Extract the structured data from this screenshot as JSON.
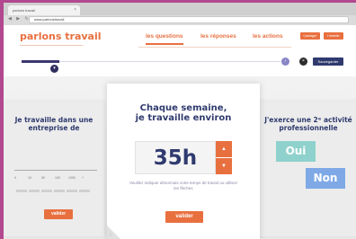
{
  "browser": {
    "tab_title": "parlons travail",
    "tab_close": "×",
    "nav_glyphs": "◀ ▶ ↻",
    "url": "www.parlonstravail"
  },
  "header": {
    "logo": "parlons travail",
    "nav": [
      {
        "label": "les questions",
        "active": true
      },
      {
        "label": "les réponses",
        "active": false
      },
      {
        "label": "les actions",
        "active": false
      }
    ],
    "share_buttons": [
      "f partager",
      "t tweeter"
    ]
  },
  "progress": {
    "value": 0.13,
    "knob_glyph": "▾",
    "next_glyph": "›",
    "close_glyph": "×",
    "save_label": "Sauvegarder"
  },
  "left_card": {
    "title": "Je travaille dans une entreprise de",
    "scale_ticks": [
      "0",
      "10",
      "50",
      "100",
      "1000",
      "+"
    ],
    "button": "valider"
  },
  "main_card": {
    "title_line1": "Chaque semaine,",
    "title_line2": "je travaille environ",
    "value": "35h",
    "step_up": "▲",
    "step_down": "▼",
    "hint": "Veuillez indiquer désormais votre temps de travail ou utilisez les flèches",
    "button": "valider",
    "back_glyph": "‹"
  },
  "right_card": {
    "title": "J'exerce une 2ᵉ activité professionnelle",
    "options": [
      "Oui",
      "Non"
    ]
  },
  "colors": {
    "accent": "#e8703f",
    "navy": "#2f3a6e",
    "frame": "#b2488f"
  }
}
